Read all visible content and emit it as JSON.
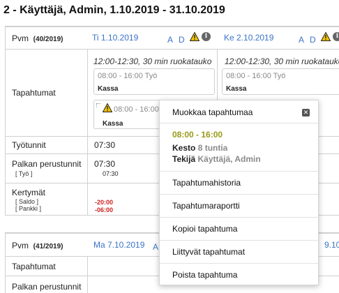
{
  "page_title": "2 - Käyttäjä, Admin, 1.10.2019 - 31.10.2019",
  "week1": {
    "pvm_label": "Pvm",
    "week_number": "(40/2019)",
    "days": [
      {
        "header": "Ti 1.10.2019",
        "a": "A",
        "d": "D"
      },
      {
        "header": "Ke 2.10.2019",
        "a": "A",
        "d": "D"
      }
    ],
    "rows": {
      "tapahtumat": "Tapahtumat",
      "tyotunnit": "Työtunnit",
      "palkan_perustunnit": "Palkan perustunnit",
      "palkan_tyo": "[ Työ ]",
      "kertymat": "Kertymät",
      "saldo": "[ Saldo ]",
      "pankki": "[ Pankki ]"
    },
    "day1": {
      "break_text": "12:00-12:30, 30 min ruokatauko",
      "event1_time": "08:00 - 16:00 Työ",
      "event1_name": "Kassa",
      "event2_time": "08:00 - 16:00",
      "event2_name": "Kassa",
      "tyotunnit": "07:30",
      "palkan": "07:30",
      "palkan_tyo": "07:30",
      "saldo": "-20:00",
      "pankki": "-06:00"
    },
    "day2": {
      "break_text": "12:00-12:30, 30 min ruokatauko",
      "event1_time": "08:00 - 16:00 Työ",
      "event1_name": "Kassa"
    }
  },
  "week2": {
    "pvm_label": "Pvm",
    "week_number": "(41/2019)",
    "days": [
      {
        "header": "Ma 7.10.2019",
        "a": "A"
      },
      {
        "header": "9.10"
      }
    ],
    "rows": {
      "tapahtumat": "Tapahtumat",
      "palkan_perustunnit": "Palkan perustunnit"
    }
  },
  "popup": {
    "title": "Muokkaa tapahtumaa",
    "time": "08:00 - 16:00",
    "kesto_label": "Kesto",
    "kesto_value": "8 tuntia",
    "tekija_label": "Tekijä",
    "tekija_value": "Käyttäjä, Admin",
    "menu": [
      "Tapahtumahistoria",
      "Tapahtumaraportti",
      "Kopioi tapahtuma",
      "Liittyvät tapahtumat",
      "Poista tapahtuma"
    ]
  },
  "colors": {
    "link_blue": "#3b73c8",
    "warning_yellow": "#f2c200",
    "negative_red": "#cc2222",
    "popup_time_olive": "#9a9a1a"
  }
}
